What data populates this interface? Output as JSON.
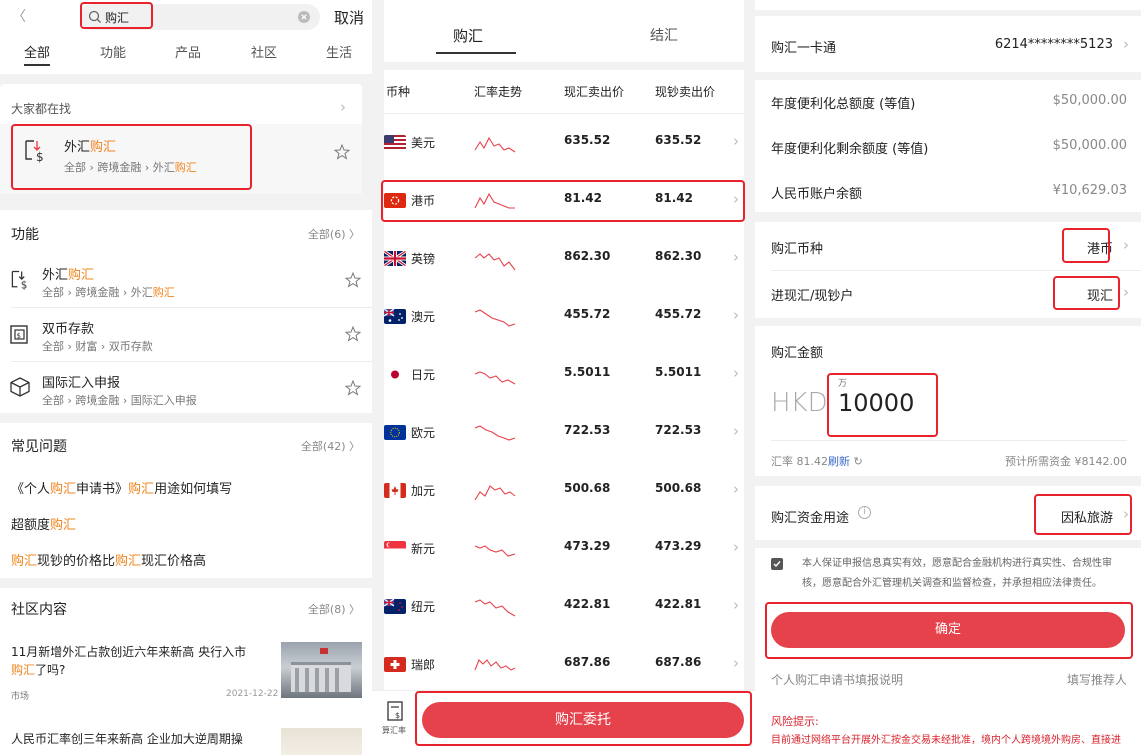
{
  "panel1": {
    "back_glyph": "〈",
    "search_value": "购汇",
    "cancel": "取消",
    "tabs": [
      "全部",
      "功能",
      "产品",
      "社区",
      "生活"
    ],
    "popular_title": "大家都在找",
    "top_result": {
      "title_a": "外汇",
      "title_b": "购汇",
      "path_a": "全部 › 跨境金融 › 外汇",
      "path_b": "购汇"
    },
    "functions_title": "功能",
    "functions_more": "全部(6) 〉",
    "functions": [
      {
        "title_a": "外汇",
        "title_b": "购汇",
        "path_a": "全部 › 跨境金融 › 外汇",
        "path_b": "购汇",
        "icon": "forex-icon"
      },
      {
        "title_a": "双币存款",
        "title_b": "",
        "path_a": "全部 › 财富 › 双币存款",
        "path_b": "",
        "icon": "deposit-icon"
      },
      {
        "title_a": "国际汇入申报",
        "title_b": "",
        "path_a": "全部 › 跨境金融 › 国际汇入申报",
        "path_b": "",
        "icon": "cube-icon"
      }
    ],
    "faq_title": "常见问题",
    "faq_more": "全部(42) 〉",
    "faq": [
      {
        "p1": "《个人",
        "h1": "购汇",
        "p2": "申请书》",
        "h2": "购汇",
        "p3": "用途如何填写"
      },
      {
        "p1": "超额度",
        "h1": "购汇",
        "p2": "",
        "h2": "",
        "p3": ""
      },
      {
        "p1": "",
        "h1": "购汇",
        "p2": "现钞的价格比",
        "h2": "购汇",
        "p3": "现汇价格高"
      }
    ],
    "community_title": "社区内容",
    "community_more": "全部(8) 〉",
    "news1": {
      "line1": "11月新增外汇占款创近六年来新高 央行入市",
      "line2_h": "购汇",
      "line2": "了吗?",
      "tag": "市场",
      "date": "2021-12-22"
    },
    "news2": {
      "line1": "人民币汇率创三年来新高 企业加大逆周期操"
    }
  },
  "panel2": {
    "tab_buy": "购汇",
    "tab_sell": "结汇",
    "headers": [
      "币种",
      "汇率走势",
      "现汇卖出价",
      "现钞卖出价"
    ],
    "rates": [
      {
        "name": "美元",
        "spot": "635.52",
        "cash": "635.52",
        "flag": "us"
      },
      {
        "name": "港币",
        "spot": "81.42",
        "cash": "81.42",
        "flag": "hk"
      },
      {
        "name": "英镑",
        "spot": "862.30",
        "cash": "862.30",
        "flag": "gb"
      },
      {
        "name": "澳元",
        "spot": "455.72",
        "cash": "455.72",
        "flag": "au"
      },
      {
        "name": "日元",
        "spot": "5.5011",
        "cash": "5.5011",
        "flag": "jp"
      },
      {
        "name": "欧元",
        "spot": "722.53",
        "cash": "722.53",
        "flag": "eu"
      },
      {
        "name": "加元",
        "spot": "500.68",
        "cash": "500.68",
        "flag": "ca"
      },
      {
        "name": "新元",
        "spot": "473.29",
        "cash": "473.29",
        "flag": "sg"
      },
      {
        "name": "纽元",
        "spot": "422.81",
        "cash": "422.81",
        "flag": "nz"
      },
      {
        "name": "瑞郎",
        "spot": "687.86",
        "cash": "687.86",
        "flag": "ch"
      }
    ],
    "calc_label": "算汇率",
    "order_button": "购汇委托",
    "accent": "#e5424b"
  },
  "panel3": {
    "card_label": "购汇一卡通",
    "card_no": "6214********5123",
    "annual_total_label": "年度便利化总额度 (等值)",
    "annual_total": "$50,000.00",
    "annual_left_label": "年度便利化剩余额度 (等值)",
    "annual_left": "$50,000.00",
    "rmb_label": "人民币账户余额",
    "rmb_balance": "¥10,629.03",
    "currency_label": "购汇币种",
    "currency_value": "港币",
    "type_label": "进现汇/现钞户",
    "type_value": "现汇",
    "amount_label": "购汇金额",
    "amount_ccy": "HKD",
    "amount_unit": "万",
    "amount_value": "10000",
    "rate_text": "汇率 81.42",
    "refresh": "刷新",
    "estimate": "预计所需资金 ¥8142.00",
    "purpose_label": "购汇资金用途",
    "purpose_value": "因私旅游",
    "declaration": "本人保证申报信息真实有效，愿意配合金融机构进行真实性、合规性审核，愿意配合外汇管理机关调查和监督检查，并承担相应法律责任。",
    "confirm": "确定",
    "guide_link": "个人购汇申请书填报说明",
    "referrer_link": "填写推荐人",
    "risk_title": "风险提示:",
    "risk_text": "目前通过网络平台开展外汇按金交易未经批准，境内个人跨境境外购房、直接进"
  }
}
